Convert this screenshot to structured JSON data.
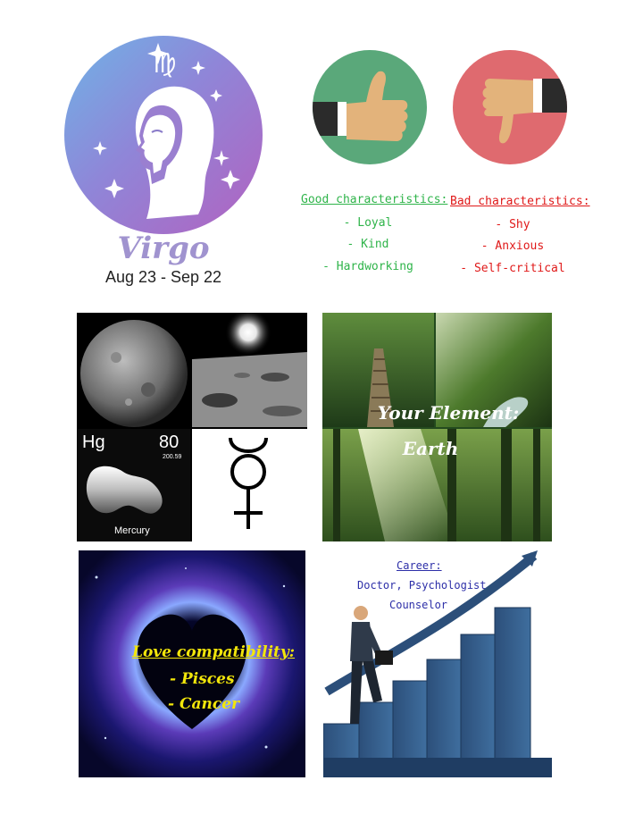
{
  "virgo": {
    "symbol": "♍",
    "name": "Virgo",
    "dates": "Aug 23 - Sep 22"
  },
  "good": {
    "title": "Good characteristics:",
    "items": [
      "- Loyal",
      "- Kind",
      "- Hardworking"
    ]
  },
  "bad": {
    "title": "Bad characteristics:",
    "items": [
      "- Shy",
      "- Anxious",
      "- Self-critical"
    ]
  },
  "planet": {
    "element_symbol": "Hg",
    "atomic_number": "80",
    "atomic_mass": "200.59",
    "element_name": "Mercury"
  },
  "element": {
    "line1": "Your Element:",
    "line2": "Earth"
  },
  "love": {
    "title": "Love compatibility:",
    "items": [
      "- Pisces",
      "- Cancer"
    ]
  },
  "career": {
    "title": "Career:",
    "line1": "Doctor, Psychologist",
    "line2": "Counselor"
  },
  "colors": {
    "good": "#2fb44a",
    "bad": "#e01919",
    "love_text": "#f2e60a",
    "career_text": "#2d2fa8",
    "virgo_text": "#a093cf"
  }
}
